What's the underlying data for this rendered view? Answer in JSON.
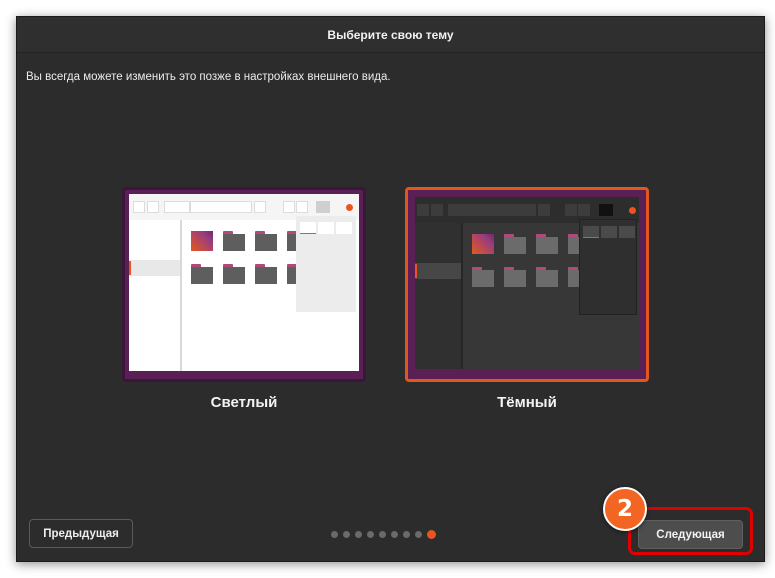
{
  "window": {
    "title": "Выберите свою тему",
    "subtitle": "Вы всегда можете изменить это позже в настройках внешнего вида."
  },
  "themes": [
    {
      "label": "Светлый",
      "selected": false
    },
    {
      "label": "Тёмный",
      "selected": true
    }
  ],
  "navigation": {
    "previous_label": "Предыдущая",
    "next_label": "Следующая",
    "page_dots_total": 9,
    "page_dots_active": 9
  },
  "annotation": {
    "step_number": "2",
    "highlight_color": "#e00000",
    "badge_color": "#f26522"
  },
  "colors": {
    "accent": "#e95420",
    "background": "#2c2c2c"
  }
}
